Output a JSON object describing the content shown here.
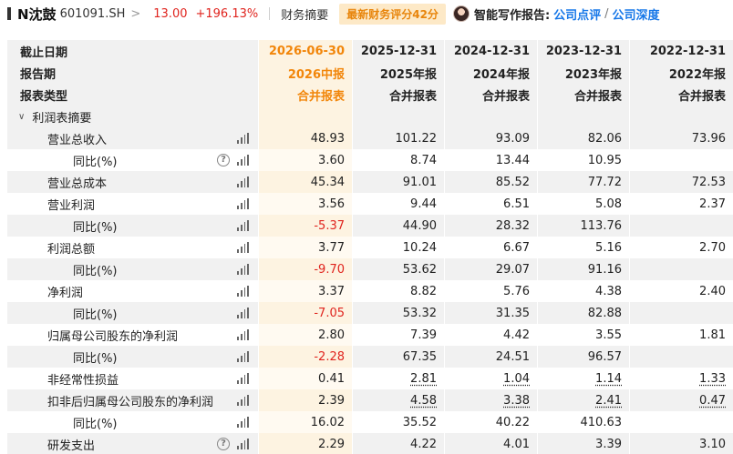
{
  "header": {
    "stock_name": "N沈鼓",
    "stock_code": "601091.SH",
    "price": "13.00",
    "change_pct": "+196.13%",
    "summary_link": "财务摘要",
    "score_badge": "最新财务评分42分",
    "smart_report_label": "智能写作报告:",
    "report_links": [
      "公司点评",
      "公司深度"
    ],
    "slash": "/"
  },
  "table": {
    "header_rows": [
      {
        "label": "截止日期",
        "values": [
          "2026-06-30",
          "2025-12-31",
          "2024-12-31",
          "2023-12-31",
          "2022-12-31"
        ]
      },
      {
        "label": "报告期",
        "values": [
          "2026中报",
          "2025年报",
          "2024年报",
          "2023年报",
          "2022年报"
        ]
      },
      {
        "label": "报表类型",
        "values": [
          "合并报表",
          "合并报表",
          "合并报表",
          "合并报表",
          "合并报表"
        ]
      }
    ],
    "section_title": "利润表摘要",
    "rows": [
      {
        "label": "营业总收入",
        "level": 1,
        "help": false,
        "values": [
          "48.93",
          "101.22",
          "93.09",
          "82.06",
          "73.96"
        ],
        "neg": [
          false,
          false,
          false,
          false,
          false
        ],
        "ul": [
          false,
          false,
          false,
          false,
          false
        ]
      },
      {
        "label": "同比(%)",
        "level": 2,
        "help": true,
        "values": [
          "3.60",
          "8.74",
          "13.44",
          "10.95",
          ""
        ],
        "neg": [
          false,
          false,
          false,
          false,
          false
        ],
        "ul": [
          false,
          false,
          false,
          false,
          false
        ]
      },
      {
        "label": "营业总成本",
        "level": 1,
        "help": false,
        "values": [
          "45.34",
          "91.01",
          "85.52",
          "77.72",
          "72.53"
        ],
        "neg": [
          false,
          false,
          false,
          false,
          false
        ],
        "ul": [
          false,
          false,
          false,
          false,
          false
        ]
      },
      {
        "label": "营业利润",
        "level": 1,
        "help": false,
        "values": [
          "3.56",
          "9.44",
          "6.51",
          "5.08",
          "2.37"
        ],
        "neg": [
          false,
          false,
          false,
          false,
          false
        ],
        "ul": [
          false,
          false,
          false,
          false,
          false
        ]
      },
      {
        "label": "同比(%)",
        "level": 2,
        "help": false,
        "values": [
          "-5.37",
          "44.90",
          "28.32",
          "113.76",
          ""
        ],
        "neg": [
          true,
          false,
          false,
          false,
          false
        ],
        "ul": [
          false,
          false,
          false,
          false,
          false
        ]
      },
      {
        "label": "利润总额",
        "level": 1,
        "help": false,
        "values": [
          "3.77",
          "10.24",
          "6.67",
          "5.16",
          "2.70"
        ],
        "neg": [
          false,
          false,
          false,
          false,
          false
        ],
        "ul": [
          false,
          false,
          false,
          false,
          false
        ]
      },
      {
        "label": "同比(%)",
        "level": 2,
        "help": false,
        "values": [
          "-9.70",
          "53.62",
          "29.07",
          "91.16",
          ""
        ],
        "neg": [
          true,
          false,
          false,
          false,
          false
        ],
        "ul": [
          false,
          false,
          false,
          false,
          false
        ]
      },
      {
        "label": "净利润",
        "level": 1,
        "help": false,
        "values": [
          "3.37",
          "8.82",
          "5.76",
          "4.38",
          "2.40"
        ],
        "neg": [
          false,
          false,
          false,
          false,
          false
        ],
        "ul": [
          false,
          false,
          false,
          false,
          false
        ]
      },
      {
        "label": "同比(%)",
        "level": 2,
        "help": false,
        "values": [
          "-7.05",
          "53.32",
          "31.35",
          "82.88",
          ""
        ],
        "neg": [
          true,
          false,
          false,
          false,
          false
        ],
        "ul": [
          false,
          false,
          false,
          false,
          false
        ]
      },
      {
        "label": "归属母公司股东的净利润",
        "level": 1,
        "help": false,
        "values": [
          "2.80",
          "7.39",
          "4.42",
          "3.55",
          "1.81"
        ],
        "neg": [
          false,
          false,
          false,
          false,
          false
        ],
        "ul": [
          false,
          false,
          false,
          false,
          false
        ]
      },
      {
        "label": "同比(%)",
        "level": 2,
        "help": false,
        "values": [
          "-2.28",
          "67.35",
          "24.51",
          "96.57",
          ""
        ],
        "neg": [
          true,
          false,
          false,
          false,
          false
        ],
        "ul": [
          false,
          false,
          false,
          false,
          false
        ]
      },
      {
        "label": "非经常性损益",
        "level": 1,
        "help": false,
        "values": [
          "0.41",
          "2.81",
          "1.04",
          "1.14",
          "1.33"
        ],
        "neg": [
          false,
          false,
          false,
          false,
          false
        ],
        "ul": [
          false,
          true,
          true,
          true,
          true
        ]
      },
      {
        "label": "扣非后归属母公司股东的净利润",
        "level": 1,
        "help": false,
        "values": [
          "2.39",
          "4.58",
          "3.38",
          "2.41",
          "0.47"
        ],
        "neg": [
          false,
          false,
          false,
          false,
          false
        ],
        "ul": [
          false,
          true,
          true,
          true,
          true
        ]
      },
      {
        "label": "同比(%)",
        "level": 2,
        "help": false,
        "values": [
          "16.02",
          "35.52",
          "40.22",
          "410.63",
          ""
        ],
        "neg": [
          false,
          false,
          false,
          false,
          false
        ],
        "ul": [
          false,
          false,
          false,
          false,
          false
        ]
      },
      {
        "label": "研发支出",
        "level": 1,
        "help": true,
        "values": [
          "2.29",
          "4.22",
          "4.01",
          "3.39",
          "3.10"
        ],
        "neg": [
          false,
          false,
          false,
          false,
          false
        ],
        "ul": [
          false,
          false,
          false,
          false,
          false
        ]
      }
    ]
  },
  "colors": {
    "accent_orange": "#f2860a",
    "negative_red": "#e0241e",
    "link_blue": "#1677e8",
    "latest_col_bg": "#fdf3e1"
  },
  "icons": {
    "row_chart": "bar-chart-icon",
    "help": "question-icon",
    "section_toggle": "chevron-down-icon",
    "header_nav": "chevron-right-icon"
  }
}
